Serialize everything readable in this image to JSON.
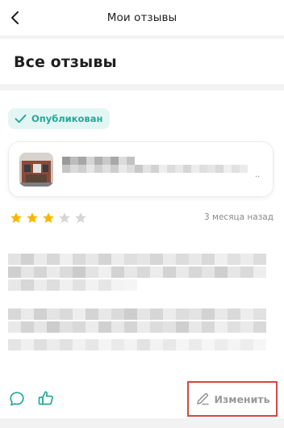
{
  "header": {
    "title": "Мои отзывы",
    "back_icon": "chevron-left-icon"
  },
  "section": {
    "title": "Все отзывы"
  },
  "review": {
    "status_label": "Опубликован",
    "status_color": "#27a79b",
    "product_ellipsis": "..",
    "rating": 3,
    "rating_max": 5,
    "date": "3 месяца назад",
    "edit_label": "Изменить",
    "star_active_color": "#f5b800",
    "star_inactive_color": "#d6d6d6",
    "accent_border": "#d9463e"
  }
}
